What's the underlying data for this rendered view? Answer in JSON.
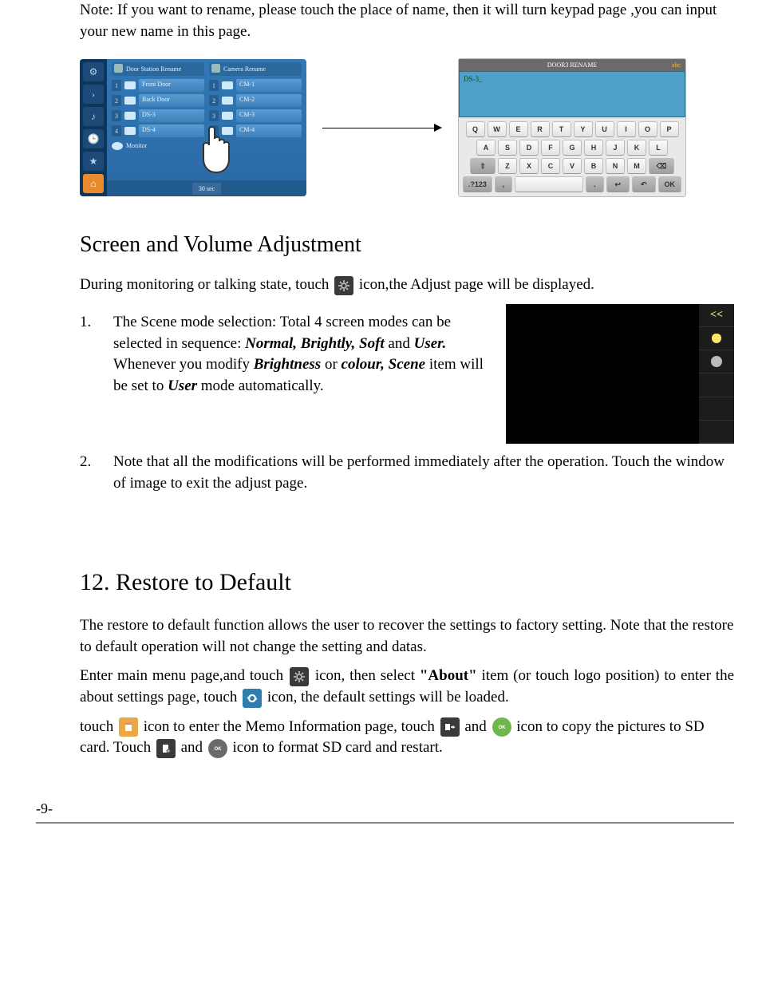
{
  "note_text_1": "Note: If you want to rename, please touch the place of name, then it will turn keypad page ,you can input your new name in this page.",
  "rename_left": {
    "sidebar_icons": [
      "⚙",
      "›",
      "♪",
      "🕒",
      "★",
      "⌂"
    ],
    "header1": "Door Station Rename",
    "header2": "Camera Rename",
    "door_rows": [
      {
        "num": "1",
        "label": "Front Door"
      },
      {
        "num": "2",
        "label": "Back Door"
      },
      {
        "num": "3",
        "label": "DS-3"
      },
      {
        "num": "4",
        "label": "DS-4"
      }
    ],
    "cam_rows": [
      {
        "num": "1",
        "label": "CM-1"
      },
      {
        "num": "2",
        "label": "CM-2"
      },
      {
        "num": "3",
        "label": "CM-3"
      },
      {
        "num": "4",
        "label": "CM-4"
      }
    ],
    "monitor_label": "Monitor",
    "footer_btn": "30 sec"
  },
  "rename_right": {
    "title": "DOOR3 RENAME",
    "mode": "abc",
    "input_value": "DS-3_",
    "row1": [
      "Q",
      "W",
      "E",
      "R",
      "T",
      "Y",
      "U",
      "I",
      "O",
      "P"
    ],
    "row2": [
      "A",
      "S",
      "D",
      "F",
      "G",
      "H",
      "J",
      "K",
      "L"
    ],
    "row3_shift": "⇧",
    "row3": [
      "Z",
      "X",
      "C",
      "V",
      "B",
      "N",
      "M"
    ],
    "row3_back": "⌫",
    "row4_sym": ".?123",
    "row4_comma": ",",
    "row4_dot": ".",
    "row4_enter": "↩",
    "row4_undo": "↶",
    "row4_ok": "OK"
  },
  "section_title": "Screen and Volume Adjustment",
  "during_1": "During monitoring or talking state, touch",
  "during_2": "icon,the Adjust page will be displayed.",
  "adjust_side_back": "<<",
  "item1_num": "1.",
  "item1_a": "The Scene mode selection: Total 4 screen modes can be selected in sequence: ",
  "item1_b": "Normal, Brightly, Soft",
  "item1_c": " and ",
  "item1_d": "User.",
  "item1_e": " Whenever you modify ",
  "item1_f": "Brightness",
  "item1_g": " or ",
  "item1_h": "colour, Scene",
  "item1_i": " item will be set to ",
  "item1_j": "User",
  "item1_k": " mode automatically.",
  "item2_num": "2.",
  "item2_text": "Note that all the modifications will be performed immediately after the operation. Touch the window of image to exit the adjust page.",
  "sec12_title": "12. Restore to Default",
  "sec12_p1": "The restore to default function allows the user to recover the settings to factory setting. Note that the restore to default operation will not change the setting and datas.",
  "sec12_p2a": "Enter main menu page,and touch",
  "sec12_p2b": "icon, then select ",
  "sec12_p2c": "\"About\"",
  "sec12_p2d": " item (or touch logo position) to enter the about settings page, touch",
  "sec12_p2e": "icon, the default settings will be loaded.",
  "sec12_p3a": "touch",
  "sec12_p3b": "icon to enter the Memo Information page, touch",
  "sec12_p3c": "and",
  "sec12_p3d": "icon to copy the pictures to SD card. Touch",
  "sec12_p3e": "and",
  "sec12_p3f": "icon to format SD card and restart.",
  "page_num": "-9-"
}
